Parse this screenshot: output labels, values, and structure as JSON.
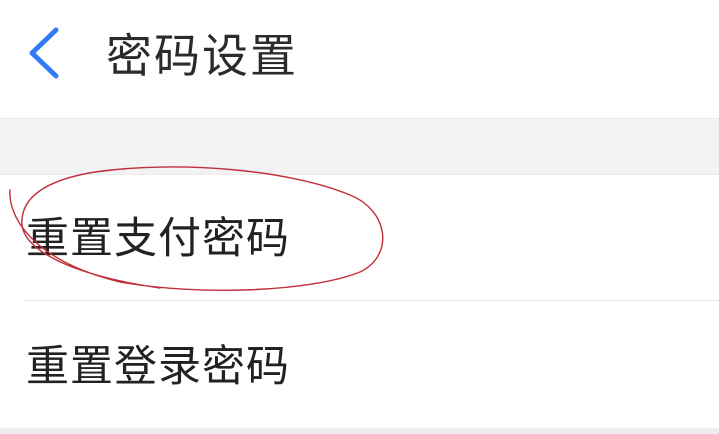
{
  "header": {
    "title": "密码设置",
    "back_icon": "chevron-left-icon",
    "accent_color": "#2f7cf6"
  },
  "settings_list": {
    "items": [
      {
        "label": "重置支付密码"
      },
      {
        "label": "重置登录密码"
      }
    ]
  },
  "annotation": {
    "shape": "hand-drawn ellipse around first item",
    "color": "#c0303a"
  }
}
